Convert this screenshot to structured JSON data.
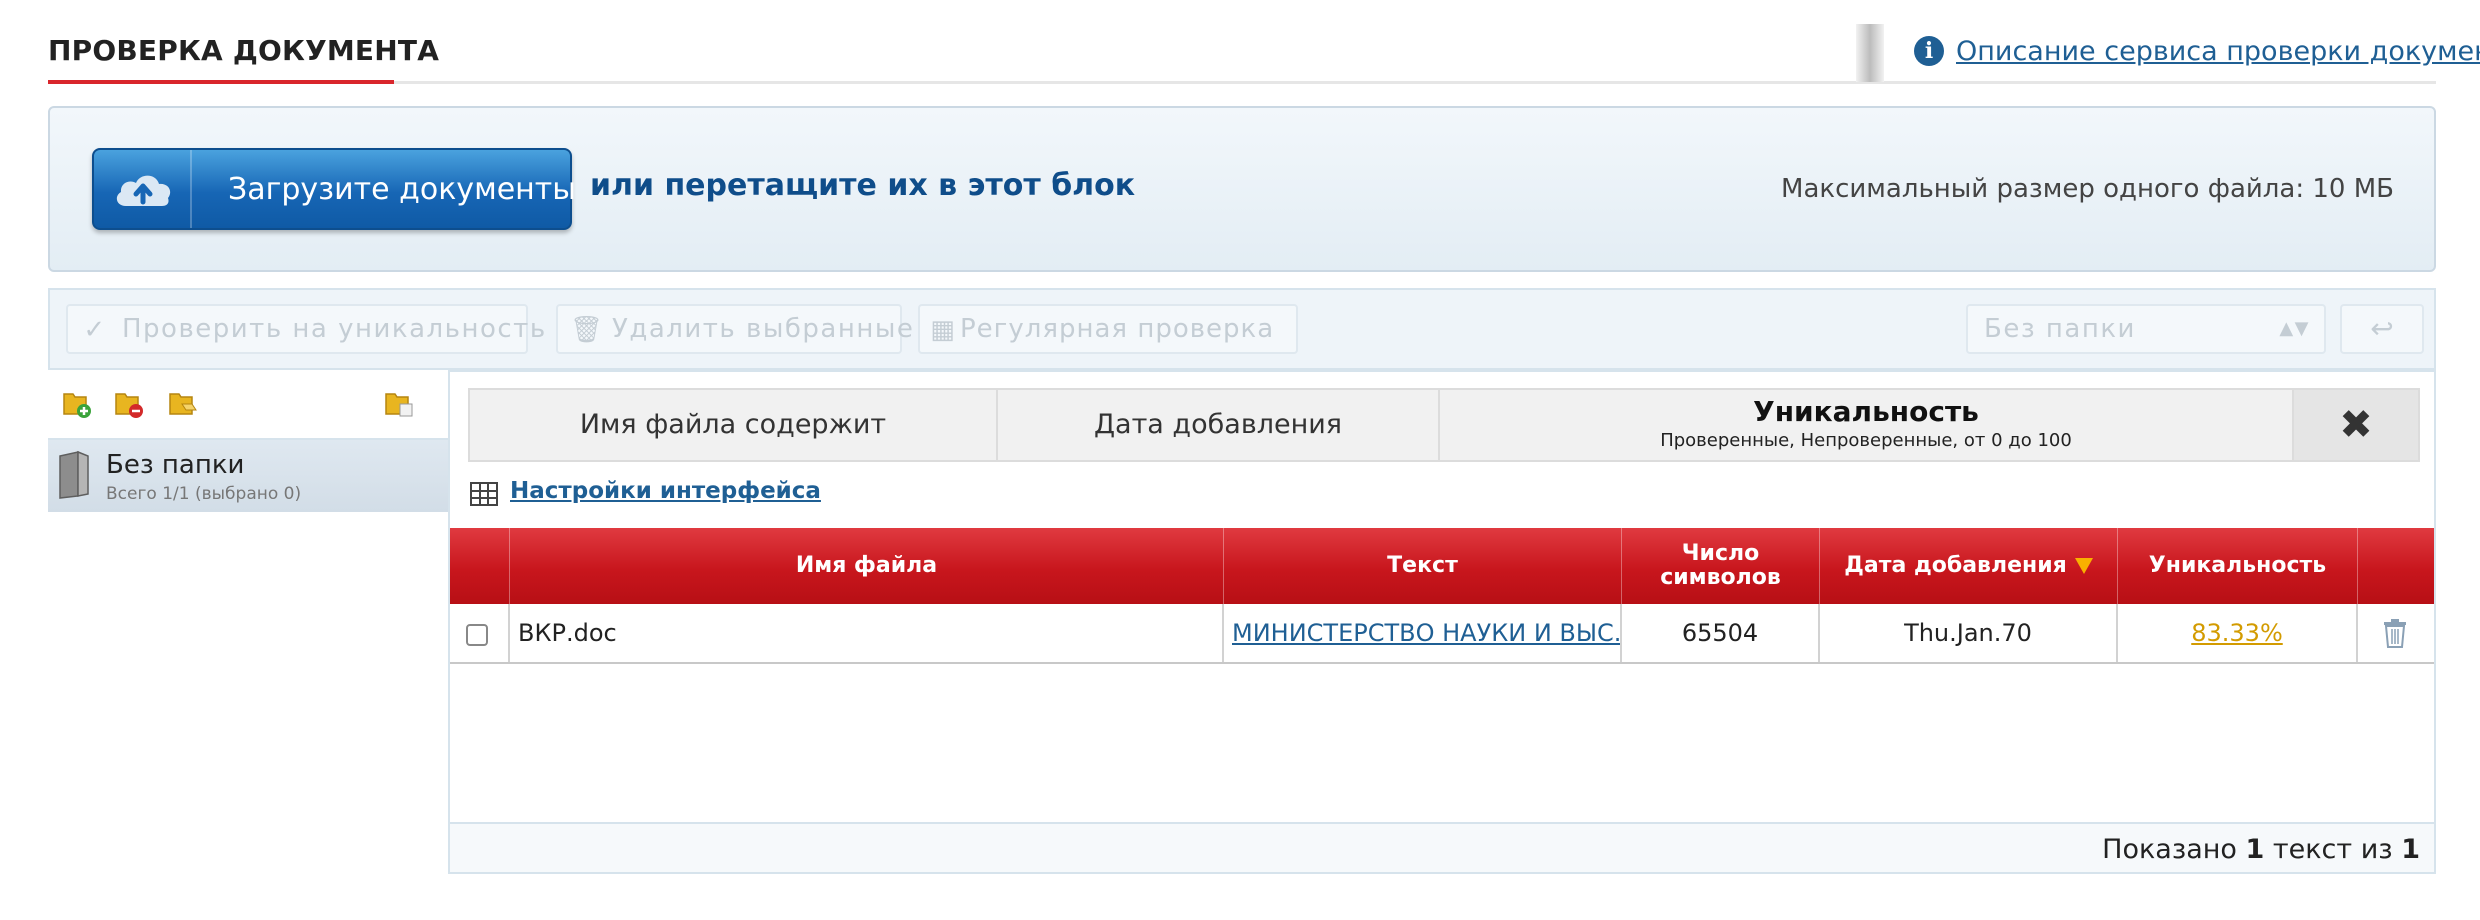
{
  "header": {
    "title": "ПРОВЕРКА ДОКУМЕНТА",
    "info_icon": "info-icon",
    "service_link": "Описание сервиса проверки документов"
  },
  "upload": {
    "button_label": "Загрузите документы",
    "button_icon": "cloud-upload-icon",
    "drop_hint": "или перетащите их в этот блок",
    "max_size": "Максимальный размер одного файла: 10 МБ"
  },
  "toolbar": {
    "check_label": "Проверить на уникальность",
    "delete_label": "Удалить выбранные",
    "regular_label": "Регулярная проверка",
    "folder_select": "Без папки",
    "back_icon": "back-arrow-icon"
  },
  "sidebar": {
    "icons": [
      "add-folder-icon",
      "delete-folder-icon",
      "move-folder-icon",
      "folder-settings-icon"
    ],
    "folder_name": "Без папки",
    "folder_count": "Всего 1/1 (выбрано 0)"
  },
  "filters": {
    "filename": "Имя файла содержит",
    "date": "Дата добавления",
    "uniqueness_title": "Уникальность",
    "uniqueness_sub": "Проверенные, Непроверенные, от 0 до 100",
    "clear": "✖"
  },
  "settings_link": "Настройки интерфейса",
  "table": {
    "columns": [
      "Имя файла",
      "Текст",
      "Число символов",
      "Дата добавления",
      "Уникальность"
    ],
    "sort_column": "Дата добавления",
    "rows": [
      {
        "checked": false,
        "filename": "ВКР.doc",
        "text": "МИНИСТЕРСТВО НАУКИ И ВЫС..",
        "chars": "65504",
        "date": "Thu.Jan.70",
        "uniqueness": "83.33%"
      }
    ]
  },
  "footer": {
    "prefix": "Показано",
    "shown": "1",
    "middle": "текст из",
    "total": "1"
  },
  "colors": {
    "accent_red": "#c8161d",
    "link_blue": "#1f5f94",
    "uniqueness_gold": "#d39b00"
  }
}
